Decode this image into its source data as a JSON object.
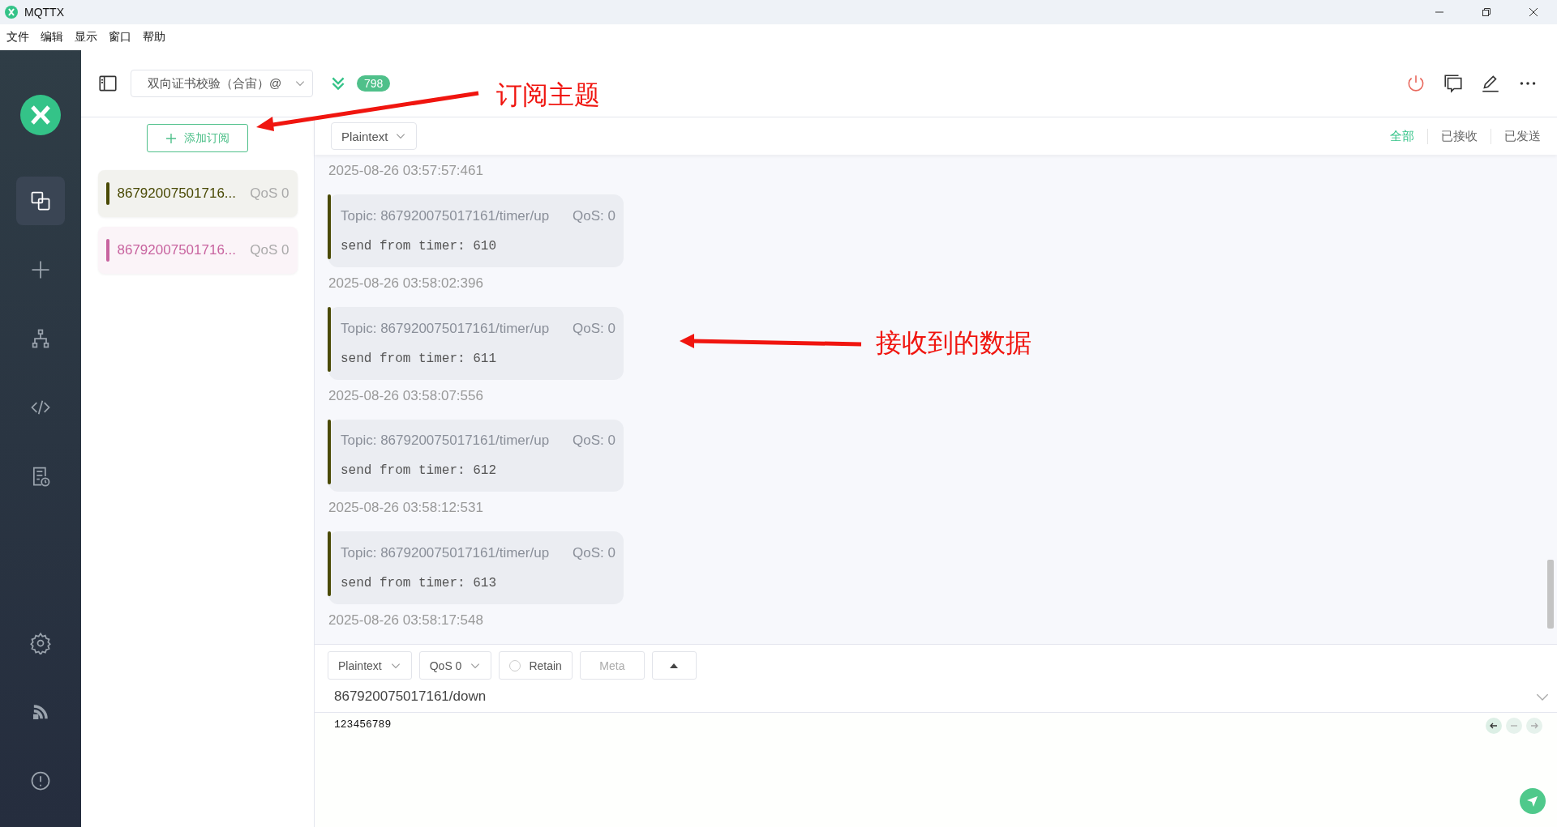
{
  "window": {
    "title": "MQTTX"
  },
  "menu": [
    "文件",
    "编辑",
    "显示",
    "窗口",
    "帮助"
  ],
  "sidebar": {
    "items": [
      {
        "kind": "connections",
        "selected": true
      },
      {
        "kind": "new",
        "selected": false
      },
      {
        "kind": "tree",
        "selected": false
      },
      {
        "kind": "script",
        "selected": false
      },
      {
        "kind": "log",
        "selected": false
      }
    ],
    "bottom_items": [
      {
        "kind": "settings"
      },
      {
        "kind": "feed"
      },
      {
        "kind": "about"
      }
    ]
  },
  "header": {
    "connection": "双向证书校验（合宙）@",
    "count": "798"
  },
  "subscriptions": {
    "add_button": "添加订阅",
    "items": [
      {
        "topic": "86792007501716...",
        "qos": "QoS 0",
        "color": "#4a4a05"
      },
      {
        "topic": "86792007501716...",
        "qos": "QoS 0",
        "color": "#c8639f"
      }
    ]
  },
  "messages_toolbar": {
    "format": "Plaintext",
    "filters": [
      {
        "label": "全部",
        "selected": true
      },
      {
        "label": "已接收",
        "selected": false
      },
      {
        "label": "已发送",
        "selected": false
      }
    ]
  },
  "messages": {
    "leading_time": "2025-08-26 03:57:57:461",
    "items": [
      {
        "topic": "Topic: 867920075017161/timer/up",
        "qos": "QoS: 0",
        "payload": "send from timer: 610",
        "time": "2025-08-26 03:58:02:396",
        "color": "#4a4a05"
      },
      {
        "topic": "Topic: 867920075017161/timer/up",
        "qos": "QoS: 0",
        "payload": "send from timer: 611",
        "time": "2025-08-26 03:58:07:556",
        "color": "#4a4a05"
      },
      {
        "topic": "Topic: 867920075017161/timer/up",
        "qos": "QoS: 0",
        "payload": "send from timer: 612",
        "time": "2025-08-26 03:58:12:531",
        "color": "#4a4a05"
      },
      {
        "topic": "Topic: 867920075017161/timer/up",
        "qos": "QoS: 0",
        "payload": "send from timer: 613",
        "time": "2025-08-26 03:58:17:548",
        "color": "#4a4a05"
      }
    ]
  },
  "publish": {
    "format": "Plaintext",
    "qos": "QoS 0",
    "retain": {
      "label": "Retain",
      "checked": false
    },
    "meta": "Meta",
    "topic": "867920075017161/down",
    "payload": "123456789"
  },
  "annotations": [
    {
      "kind": "subscribe",
      "text": "订阅主题"
    },
    {
      "kind": "received",
      "text": "接收到的数据"
    }
  ]
}
